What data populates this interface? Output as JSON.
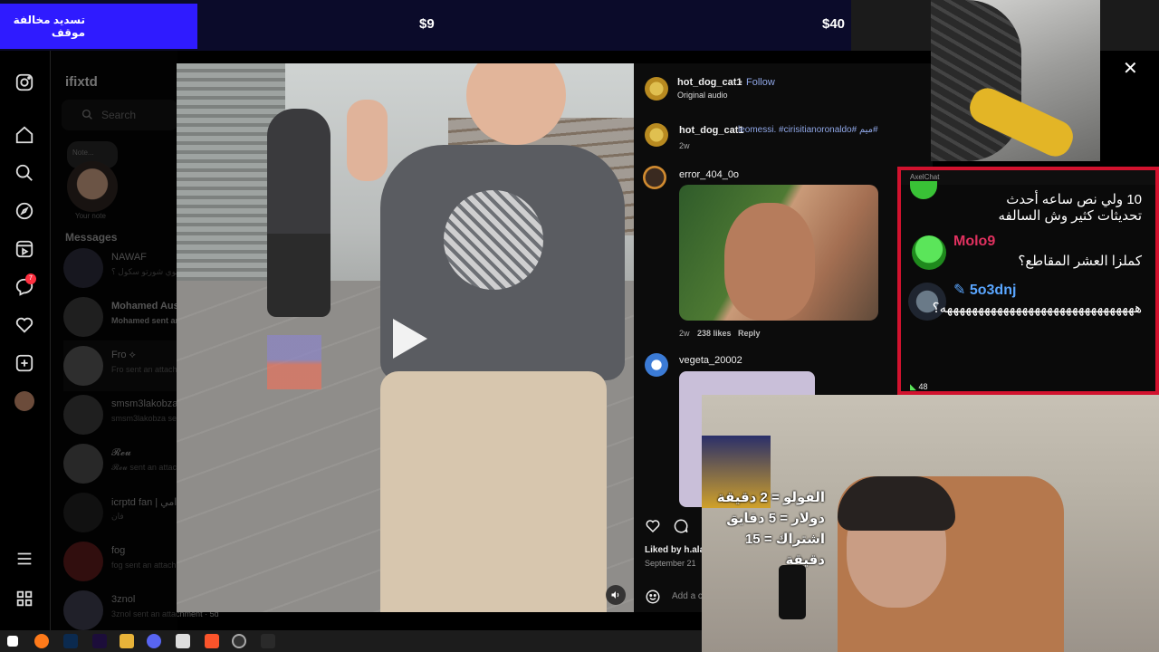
{
  "donation_bar": {
    "label": "تسديد مخالفة موقف",
    "price_mid": "$9",
    "price_right": "$40"
  },
  "nav": {
    "icons": [
      "instagram-icon",
      "home-icon",
      "search-icon",
      "explore-icon",
      "reels-icon",
      "messages-icon",
      "notifications-icon",
      "create-icon",
      "profile-icon",
      "more-icon",
      "apps-icon"
    ],
    "messages_badge": "7"
  },
  "messages_panel": {
    "username": "ifixtd",
    "search_placeholder": "Search",
    "note_label": "Note...",
    "your_note": "Your note",
    "heading": "Messages",
    "conversations": [
      {
        "name": "NAWAF",
        "sub": "سوي شورتو سكول ؟"
      },
      {
        "name": "Mohamed Aus",
        "sub": "Mohamed sent an"
      },
      {
        "name": "Fro ⟡",
        "sub": "Fro sent an attachm"
      },
      {
        "name": "smsm3lakobza",
        "sub": "smsm3lakobza sent"
      },
      {
        "name": "𝓡𝓮𝓾",
        "sub": "𝓡𝓮𝓾 sent an attach"
      },
      {
        "name": "icrptd fan | رامي",
        "sub": "فان"
      },
      {
        "name": "fog",
        "sub": "fog sent an attachm"
      },
      {
        "name": "3znol",
        "sub": "3znol sent an attachment · 5d"
      }
    ]
  },
  "post": {
    "author": "hot_dog_cat1",
    "follow": "Follow",
    "audio": "Original audio",
    "caption_author": "hot_dog_cat1",
    "caption_text": "leomessi. #cirisitianoronaldo# ميم#",
    "caption_time": "2w",
    "liked_by": "Liked by h.ala",
    "date": "September 21",
    "add_comment": "Add a c"
  },
  "comments": [
    {
      "user": "error_404_0o",
      "time": "2w",
      "likes": "238 likes",
      "reply": "Reply"
    },
    {
      "user": "vegeta_20002"
    }
  ],
  "chat": {
    "app_title": "AxelChat",
    "msg1": "10 ولي نص ساعه أحدث تحديثات كثير وش السالفه",
    "user2": "Molo9",
    "msg2": "كملزا العشر المقاطع؟",
    "user3": "5o3dnj",
    "msg3": "هههههههههههههههههههههههههههههههه؟",
    "viewer_count": "48"
  },
  "rates": {
    "line1": "الفولو = 2 دقيقة",
    "line2": "دولار = 5 دقايق",
    "line3": "اشتراك = 15 دقيقة"
  },
  "colors": {
    "donation_accent": "#2f1bff",
    "chat_border": "#d2122e",
    "link": "#8fa6e6",
    "molo9": "#e0315f",
    "user3": "#5aa6ff"
  }
}
